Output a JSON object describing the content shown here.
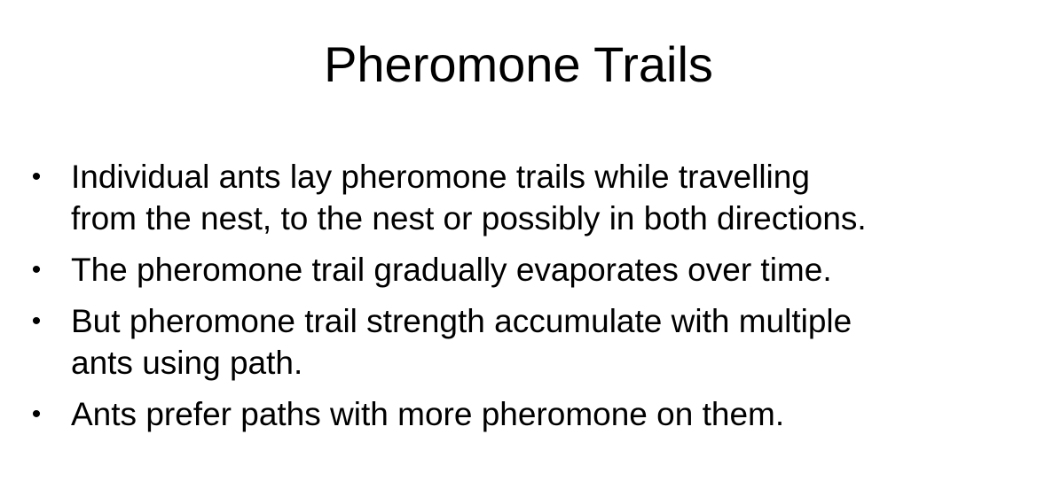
{
  "slide": {
    "title": "Pheromone Trails",
    "bullet_symbol": "•",
    "bullets": [
      {
        "lines": [
          "Individual ants lay pheromone trails while travelling",
          "from the nest, to the nest or possibly in both directions."
        ]
      },
      {
        "lines": [
          "The pheromone trail gradually evaporates over time."
        ]
      },
      {
        "lines": [
          "But pheromone trail strength accumulate with multiple",
          "ants using path."
        ]
      },
      {
        "lines": [
          "Ants prefer paths with more pheromone on them."
        ]
      }
    ]
  }
}
